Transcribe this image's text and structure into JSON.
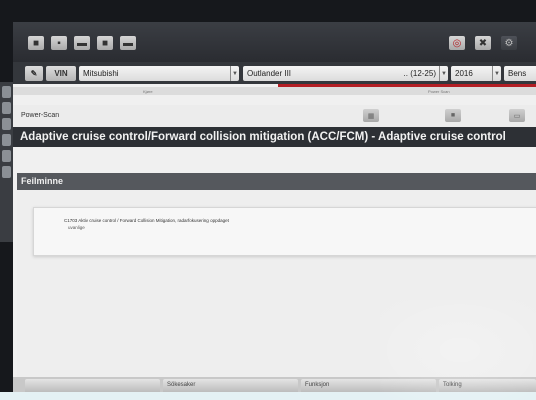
{
  "toolbar": {
    "left_icons": [
      "home-icon",
      "connect-icon",
      "car-icon",
      "truck-icon",
      "settings-icon"
    ],
    "right_icons": [
      "help-icon",
      "user-icon",
      "gear-icon"
    ]
  },
  "vehicle": {
    "vin_icon": "wrench-icon",
    "vin_label": "VIN",
    "make": "Mitsubishi",
    "model": "Outlander III",
    "year_range": ".. (12-25)",
    "year": "2016",
    "fuel": "Bens"
  },
  "subtabs": {
    "left": "Kjøre",
    "right": "Power Scan"
  },
  "scanbar": {
    "label": "Power-Scan",
    "buttons": [
      "scan-icon",
      "stop-icon",
      "print-icon"
    ]
  },
  "page_title": "Adaptive cruise control/Forward collision mitigation (ACC/FCM) - Adaptive cruise control",
  "section_title": "Feilminne",
  "dtc": {
    "line1": "C1703 Aktiv cruise control / Forward Collision Mitigation, radarfokusering oppdaget",
    "line2": "uvanlige"
  },
  "footer": {
    "items": [
      "",
      "Sökesaker",
      "Funksjon",
      "Tolking"
    ]
  }
}
